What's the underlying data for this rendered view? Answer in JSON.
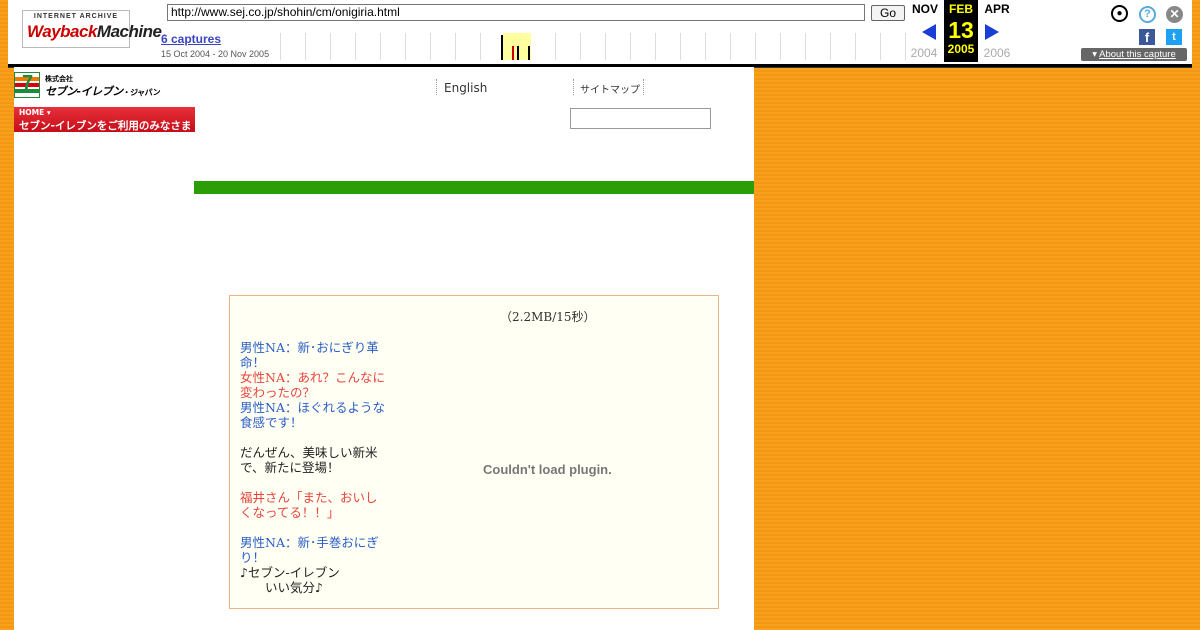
{
  "wayback": {
    "logo_top": "INTERNET ARCHIVE",
    "logo_wayback": "Wayback",
    "logo_machine": "Machine",
    "url": "http://www.sej.co.jp/shohin/cm/onigiria.html",
    "go_label": "Go",
    "captures_label": "6 captures",
    "date_range": "15 Oct 2004 - 20 Nov 2005",
    "prev_month": "NOV",
    "prev_year": "2004",
    "cur_month": "FEB",
    "cur_day": "13",
    "cur_year": "2005",
    "next_month": "APR",
    "next_year": "2006",
    "about_label": "About this capture",
    "icons": {
      "user": "user-icon",
      "help": "help-icon",
      "close": "close-icon",
      "facebook": "facebook-icon",
      "twitter": "twitter-icon"
    }
  },
  "site": {
    "corp_small": "株式会社",
    "corp_name": "セブン-イレブン",
    "corp_suffix": "・ジャパン",
    "logo_number": "7",
    "home_label": "HOME",
    "banner_text": "セブン-イレブンをご利用のみなさま",
    "nav_english": "English",
    "nav_sitemap": "サイトマップ",
    "colors": {
      "green_bar": "#2b9e07",
      "banner_red": "#d7000f",
      "male": "#2a5fc6",
      "female": "#e8453c"
    }
  },
  "cm": {
    "file_size": "（2.2MB/15秒）",
    "plugin_message": "Couldn't load plugin.",
    "script": [
      {
        "type": "male",
        "text": "男性NA：新･おにぎり革命！"
      },
      {
        "type": "female",
        "text": "女性NA：あれ？こんなに変わったの？"
      },
      {
        "type": "male",
        "text": "男性NA：ほぐれるような食感です！"
      },
      {
        "type": "gap",
        "text": ""
      },
      {
        "type": "plain",
        "text": "だんぜん、美味しい新米で、新たに登場！"
      },
      {
        "type": "gap",
        "text": ""
      },
      {
        "type": "female",
        "text": "福井さん「また、おいしくなってる！！」"
      },
      {
        "type": "gap",
        "text": ""
      },
      {
        "type": "male",
        "text": "男性NA：新･手巻おにぎり！"
      },
      {
        "type": "plain",
        "text": "♪セブン-イレブン"
      },
      {
        "type": "plain",
        "text": "　　いい気分♪"
      }
    ]
  }
}
